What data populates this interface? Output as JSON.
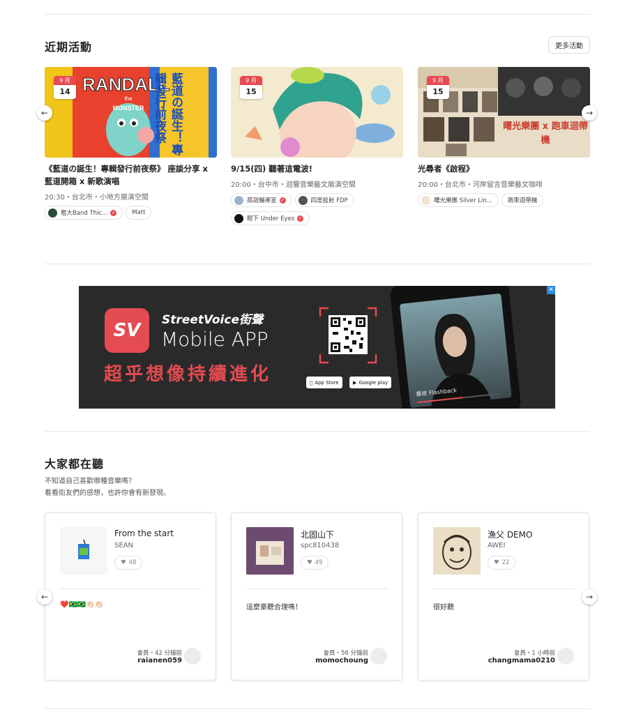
{
  "events_section": {
    "title": "近期活動",
    "more_label": "更多活動",
    "events": [
      {
        "month": "9 月",
        "day": "14",
        "poster_text": "藍道の誕生！專輯發行前夜祭",
        "title": "《藍道の誕生！專輯發行前夜祭》 座談分享 x 藍道開箱 x 新歌演唱",
        "meta": "20:30・台北市・小地方展演空間",
        "tags": [
          {
            "name": "粗大Band Thic...",
            "verified": true
          },
          {
            "name": "Matt",
            "verified": false
          }
        ]
      },
      {
        "month": "9 月",
        "day": "15",
        "title": "9/15(四) 聽著這電波!",
        "meta": "20:00・台中市・迴響音樂藝文展演空間",
        "tags": [
          {
            "name": "孤寂輔導室",
            "verified": true
          },
          {
            "name": "四度投射 FDP",
            "verified": false
          },
          {
            "name": "眼下 Under Eyes",
            "verified": true
          }
        ]
      },
      {
        "month": "9 月",
        "day": "15",
        "poster_text": "曙光樂團 x 跑車迴帶機",
        "title": "光尋者《啟程》",
        "meta": "20:00・台北市・河岸留言音樂藝文咖啡",
        "tags": [
          {
            "name": "曙光樂團 Silver Lin...",
            "verified": false
          },
          {
            "name": "跑車迴帶機",
            "verified": false
          }
        ]
      }
    ]
  },
  "banner": {
    "logo_text": "SV",
    "brand": "StreetVoice街聲",
    "product": "Mobile APP",
    "slogan": "超乎想像持續進化",
    "app_store": "App Store",
    "google_play": "Google play",
    "phone_song": "蔡依 Flashback",
    "ad_close": "✕"
  },
  "listen_section": {
    "title": "大家都在聽",
    "subtitle_1": "不知道自己喜歡哪種音樂嗎？",
    "subtitle_2": "看看街友們的感想，也許你會有新發現。",
    "cards": [
      {
        "song": "From the start",
        "artist": "SEAN",
        "likes": "48",
        "comment": "❤️🇧🇷🇧🇷👏🏻👏🏻",
        "when": "會員・42 分鐘前",
        "user": "raianen059"
      },
      {
        "song": "北固山下",
        "artist": "spc810438",
        "likes": "49",
        "comment": "這麼豪聽合理嗎！",
        "when": "會員・56 分鐘前",
        "user": "momochoung"
      },
      {
        "song": "漁父 DEMO",
        "artist": "AWEI",
        "likes": "22",
        "comment": "很好聽",
        "when": "會員・1 小時前",
        "user": "changmama0210"
      }
    ]
  },
  "colors": {
    "accent": "#e84a52",
    "banner_bg": "#2a2a2a",
    "divider": "#e6e6e6"
  }
}
